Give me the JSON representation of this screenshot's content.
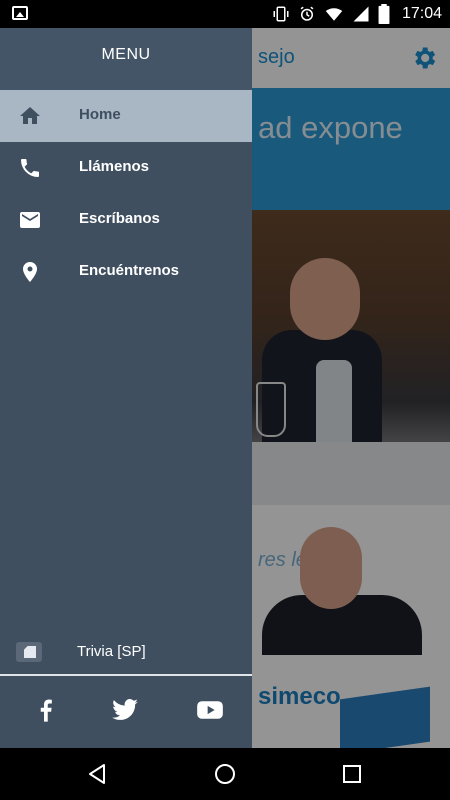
{
  "status_bar": {
    "time": "17:04",
    "icons": [
      "image-icon",
      "vibrate-icon",
      "alarm-icon",
      "wifi-icon",
      "signal-icon",
      "battery-icon"
    ]
  },
  "app": {
    "title": "sejo",
    "banner_text": "ad expone",
    "card2_text": "res le las c",
    "card3_logo": "simeco",
    "accent_color": "#1a8fd1"
  },
  "drawer": {
    "title": "MENU",
    "items": [
      {
        "label": "Home",
        "icon": "home-icon",
        "active": true
      },
      {
        "label": "Llámenos",
        "icon": "phone-icon",
        "active": false
      },
      {
        "label": "Escríbanos",
        "icon": "mail-icon",
        "active": false
      },
      {
        "label": "Encuéntrenos",
        "icon": "location-pin-icon",
        "active": false
      }
    ],
    "trivia_label": "Trivia [SP]",
    "social": [
      "facebook-icon",
      "twitter-icon",
      "youtube-icon"
    ],
    "bg_color": "#3f4f60",
    "active_color": "#a9b7c4"
  },
  "nav_bar": {
    "buttons": [
      "back-icon",
      "home-circle-icon",
      "recents-icon"
    ]
  }
}
